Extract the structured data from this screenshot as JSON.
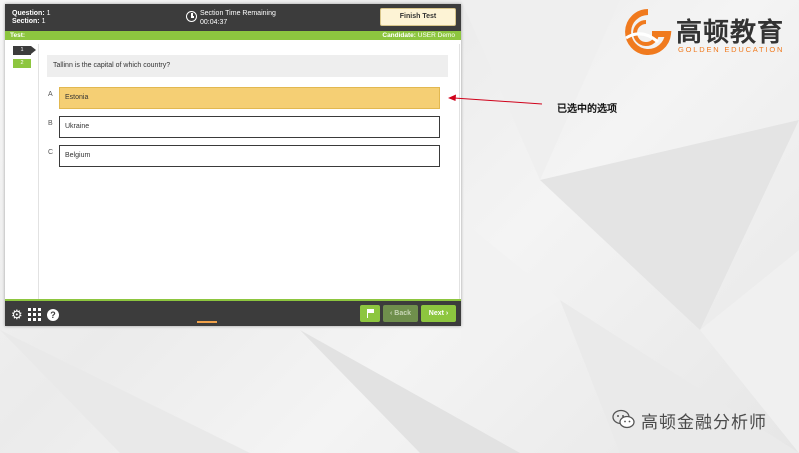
{
  "header": {
    "question_label": "Question:",
    "question_value": "1",
    "section_label": "Section:",
    "section_value": "1",
    "timer_label": "Section Time Remaining",
    "timer_value": "00:04:37",
    "finish_label": "Finish Test"
  },
  "status_bar": {
    "test_label": "Test:",
    "candidate_label": "Candidate:",
    "candidate_name": "USER Demo"
  },
  "nav": {
    "items": [
      {
        "label": "1",
        "state": "current"
      },
      {
        "label": "2",
        "state": "other"
      }
    ]
  },
  "question": {
    "text": "Tallinn is the capital of which country?",
    "options": [
      {
        "letter": "A",
        "text": "Estonia",
        "selected": true
      },
      {
        "letter": "B",
        "text": "Ukraine",
        "selected": false
      },
      {
        "letter": "C",
        "text": "Belgium",
        "selected": false
      }
    ]
  },
  "footer": {
    "back_label": "Back",
    "next_label": "Next"
  },
  "annotation": {
    "text": "已选中的选项"
  },
  "logo": {
    "cn": "高顿教育",
    "en": "GOLDEN EDUCATION"
  },
  "watermark": {
    "text": "高顿金融分析师"
  },
  "colors": {
    "header_bg": "#3c3c3c",
    "accent_green": "#8dc63f",
    "selected_option": "#f5cf74",
    "annotation_arrow": "#d0021b",
    "brand_orange": "#f07a1e"
  }
}
